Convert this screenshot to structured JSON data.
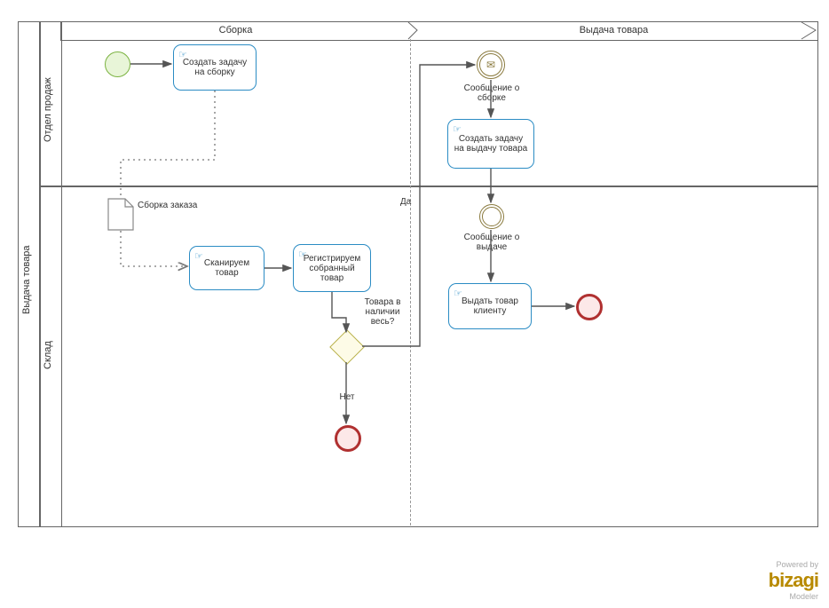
{
  "pool_title": "Выдача товара",
  "lanes": {
    "sales": "Отдел продаж",
    "warehouse": "Склад"
  },
  "phases": {
    "assembly": "Сборка",
    "delivery": "Выдача товара"
  },
  "tasks": {
    "create_assembly": "Создать задачу на сборку",
    "scan": "Сканируем товар",
    "register": "Регистрируем собранный товар",
    "create_delivery": "Создать задачу на выдачу товара",
    "issue": "Выдать товар клиенту"
  },
  "events": {
    "msg_assembly": "Сообщение о сборке",
    "msg_delivery": "Сообщение о выдаче"
  },
  "data_objects": {
    "order_assembly": "Сборка заказа"
  },
  "gateway": {
    "question": "Товара в наличии весь?",
    "yes": "Да",
    "no": "Нет"
  },
  "footer": {
    "powered": "Powered by",
    "brand": "bizagi",
    "product": "Modeler"
  }
}
